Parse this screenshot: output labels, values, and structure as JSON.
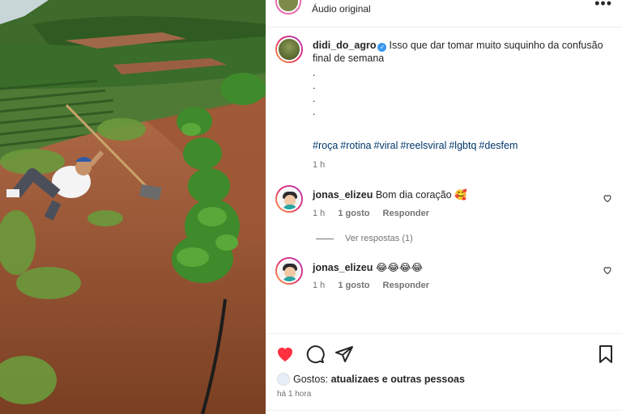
{
  "header": {
    "audio_label": "Áudio original"
  },
  "caption": {
    "username": "didi_do_agro",
    "text_line": "Isso que dar tomar muito suquinho da confusão final de semana",
    "dots": [
      ".",
      ".",
      ".",
      "."
    ],
    "hashtags": [
      "#roça",
      "#rotina",
      "#viral",
      "#reelsviral",
      "#lgbtq",
      "#desfem"
    ],
    "time": "1 h"
  },
  "comments": [
    {
      "username": "jonas_elizeu",
      "text": "Bom dia coração 🥰",
      "time": "1 h",
      "likes": "1 gosto",
      "reply": "Responder"
    },
    {
      "username": "jonas_elizeu",
      "text": "😂😂😂😂",
      "time": "1 h",
      "likes": "1 gosto",
      "reply": "Responder"
    }
  ],
  "view_replies": "Ver respostas (1)",
  "likes_summary": {
    "prefix": "Gostos:",
    "names": "atualizaes e outras pessoas"
  },
  "posted_ago": "há 1 hora",
  "colors": {
    "like_red": "#ff3040",
    "hashtag_blue": "#00376b",
    "verified_blue": "#3897f0",
    "muted_text": "#737373"
  }
}
